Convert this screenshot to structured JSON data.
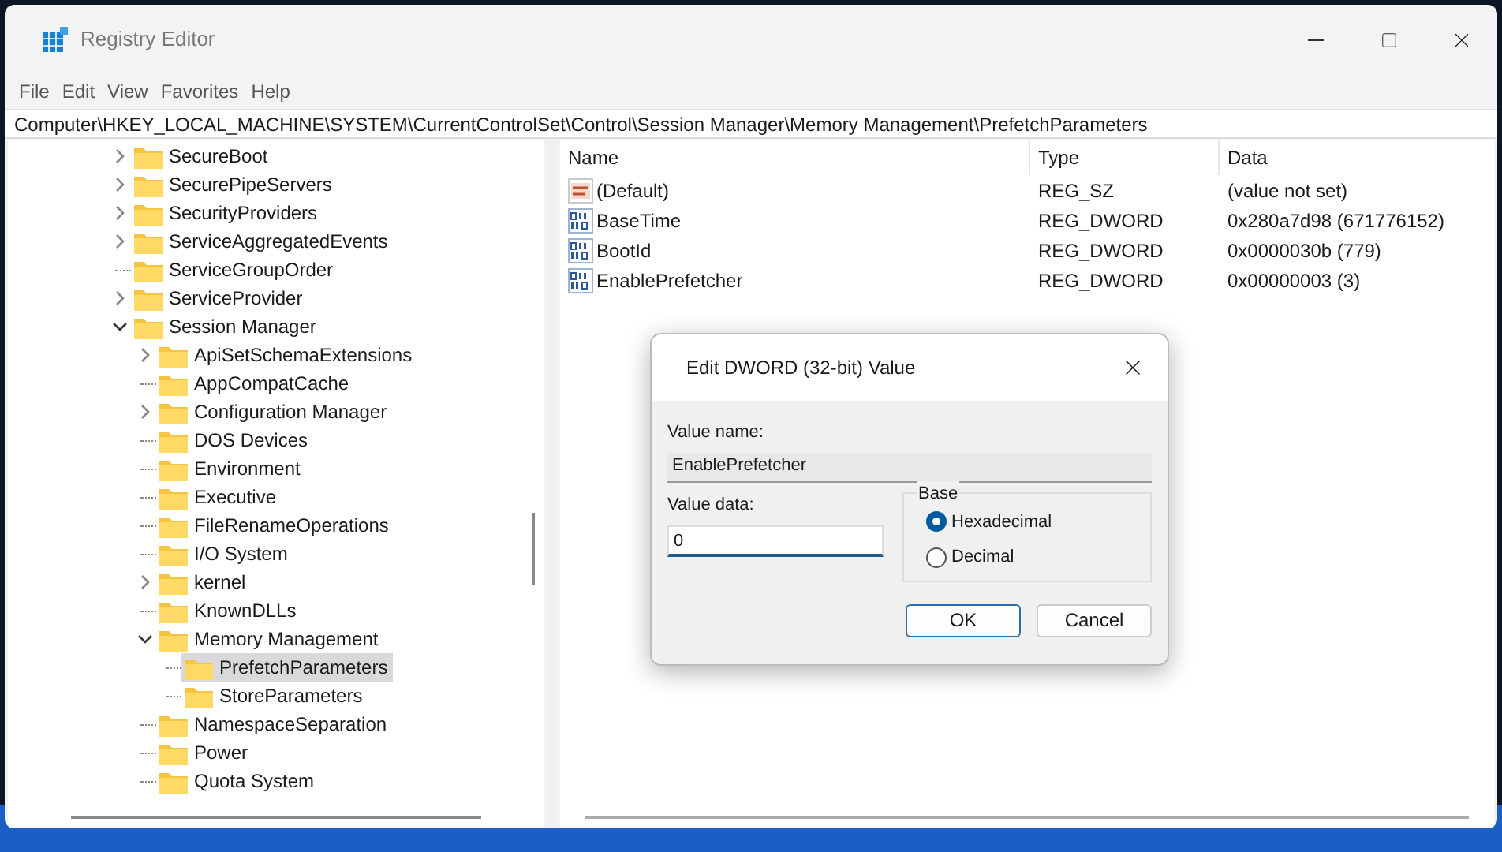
{
  "window": {
    "title": "Registry Editor"
  },
  "menu": [
    "File",
    "Edit",
    "View",
    "Favorites",
    "Help"
  ],
  "address": "Computer\\HKEY_LOCAL_MACHINE\\SYSTEM\\CurrentControlSet\\Control\\Session Manager\\Memory Management\\PrefetchParameters",
  "tree": [
    {
      "label": "SecureBoot",
      "kind": "branch",
      "expanded": false,
      "selected": false
    },
    {
      "label": "SecurePipeServers",
      "kind": "branch",
      "expanded": false,
      "selected": false
    },
    {
      "label": "SecurityProviders",
      "kind": "branch",
      "expanded": false,
      "selected": false
    },
    {
      "label": "ServiceAggregatedEvents",
      "kind": "branch",
      "expanded": false,
      "selected": false
    },
    {
      "label": "ServiceGroupOrder",
      "kind": "leaf",
      "selected": false
    },
    {
      "label": "ServiceProvider",
      "kind": "branch",
      "expanded": false,
      "selected": false
    },
    {
      "label": "Session Manager",
      "kind": "branch",
      "expanded": true,
      "selected": false,
      "children": [
        {
          "label": "ApiSetSchemaExtensions",
          "kind": "branch",
          "expanded": false,
          "selected": false
        },
        {
          "label": "AppCompatCache",
          "kind": "leaf",
          "selected": false
        },
        {
          "label": "Configuration Manager",
          "kind": "branch",
          "expanded": false,
          "selected": false
        },
        {
          "label": "DOS Devices",
          "kind": "leaf",
          "selected": false
        },
        {
          "label": "Environment",
          "kind": "leaf",
          "selected": false
        },
        {
          "label": "Executive",
          "kind": "leaf",
          "selected": false
        },
        {
          "label": "FileRenameOperations",
          "kind": "leaf",
          "selected": false
        },
        {
          "label": "I/O System",
          "kind": "leaf",
          "selected": false
        },
        {
          "label": "kernel",
          "kind": "branch",
          "expanded": false,
          "selected": false
        },
        {
          "label": "KnownDLLs",
          "kind": "leaf",
          "selected": false
        },
        {
          "label": "Memory Management",
          "kind": "branch",
          "expanded": true,
          "selected": false,
          "children": [
            {
              "label": "PrefetchParameters",
              "kind": "leaf",
              "selected": true
            },
            {
              "label": "StoreParameters",
              "kind": "leaf",
              "selected": false
            }
          ]
        },
        {
          "label": "NamespaceSeparation",
          "kind": "leaf",
          "selected": false
        },
        {
          "label": "Power",
          "kind": "leaf",
          "selected": false
        },
        {
          "label": "Quota System",
          "kind": "leaf",
          "selected": false
        }
      ]
    }
  ],
  "values": {
    "columns": [
      "Name",
      "Type",
      "Data"
    ],
    "rows": [
      {
        "kind": "string",
        "name": "(Default)",
        "type": "REG_SZ",
        "data": "(value not set)"
      },
      {
        "kind": "binary",
        "name": "BaseTime",
        "type": "REG_DWORD",
        "data": "0x280a7d98 (671776152)"
      },
      {
        "kind": "binary",
        "name": "BootId",
        "type": "REG_DWORD",
        "data": "0x0000030b (779)"
      },
      {
        "kind": "binary",
        "name": "EnablePrefetcher",
        "type": "REG_DWORD",
        "data": "0x00000003 (3)"
      }
    ]
  },
  "dialog": {
    "title": "Edit DWORD (32-bit) Value",
    "value_name_label": "Value name:",
    "value_name": "EnablePrefetcher",
    "value_data_label": "Value data:",
    "value_data": "0",
    "base_label": "Base",
    "base_options": [
      {
        "label": "Hexadecimal",
        "selected": true
      },
      {
        "label": "Decimal",
        "selected": false
      }
    ],
    "buttons": [
      {
        "label": "OK",
        "kind": "primary"
      },
      {
        "label": "Cancel",
        "kind": "secondary"
      }
    ]
  }
}
